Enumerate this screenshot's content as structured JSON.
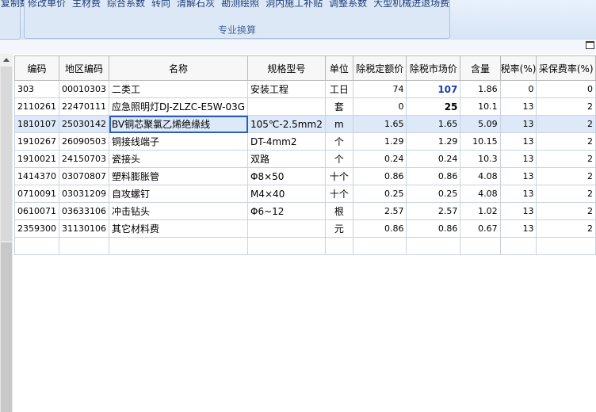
{
  "ribbon": {
    "left_label": "复制数",
    "items": [
      "修改单价",
      "主材费",
      "综合系数",
      "转向",
      "清解石灰",
      "勘测绘照",
      "洞内施工补贴",
      "调整系数",
      "大型机械进退场费"
    ],
    "group_label": "专业换算"
  },
  "grid": {
    "columns": [
      "编码",
      "地区编码",
      "名称",
      "规格型号",
      "单位",
      "除税定额价",
      "除税市场价",
      "含量",
      "税率(%)",
      "采保费率(%)"
    ],
    "rows": [
      {
        "code": "303",
        "region": "00010303",
        "name": "二类工",
        "spec": "安装工程",
        "unit": "工日",
        "base": "74",
        "market": "107",
        "qty": "1.86",
        "tax": "0",
        "fee": "0"
      },
      {
        "code": "2110261",
        "region": "22470111",
        "name": "应急照明灯DJ-ZLZC-E5W-03G",
        "spec": "",
        "unit": "套",
        "base": "0",
        "market": "25",
        "qty": "10.1",
        "tax": "13",
        "fee": "2"
      },
      {
        "code": "1810107",
        "region": "25030142",
        "name": "BV铜芯聚氯乙烯绝缘线",
        "spec": "105℃-2.5mm2",
        "unit": "m",
        "base": "1.65",
        "market": "1.65",
        "qty": "5.09",
        "tax": "13",
        "fee": "2"
      },
      {
        "code": "1910267",
        "region": "26090503",
        "name": "铜接线端子",
        "spec": "DT-4mm2",
        "unit": "个",
        "base": "1.29",
        "market": "1.29",
        "qty": "10.15",
        "tax": "13",
        "fee": "2"
      },
      {
        "code": "1910021",
        "region": "24150703",
        "name": "瓷接头",
        "spec": "双路",
        "unit": "个",
        "base": "0.24",
        "market": "0.24",
        "qty": "10.3",
        "tax": "13",
        "fee": "2"
      },
      {
        "code": "1414370",
        "region": "03070807",
        "name": "塑料膨胀管",
        "spec": "Φ8×50",
        "unit": "十个",
        "base": "0.86",
        "market": "0.86",
        "qty": "4.08",
        "tax": "13",
        "fee": "2"
      },
      {
        "code": "0710091",
        "region": "03031209",
        "name": "自攻螺钉",
        "spec": "M4×40",
        "unit": "十个",
        "base": "0.25",
        "market": "0.25",
        "qty": "4.08",
        "tax": "13",
        "fee": "2"
      },
      {
        "code": "0610071",
        "region": "03633106",
        "name": "冲击钻头",
        "spec": "Φ6~12",
        "unit": "根",
        "base": "2.57",
        "market": "2.57",
        "qty": "1.02",
        "tax": "13",
        "fee": "2"
      },
      {
        "code": "2359300",
        "region": "31130106",
        "name": "其它材料费",
        "spec": "",
        "unit": "元",
        "base": "0.86",
        "market": "0.86",
        "qty": "0.67",
        "tax": "13",
        "fee": "2"
      }
    ]
  }
}
